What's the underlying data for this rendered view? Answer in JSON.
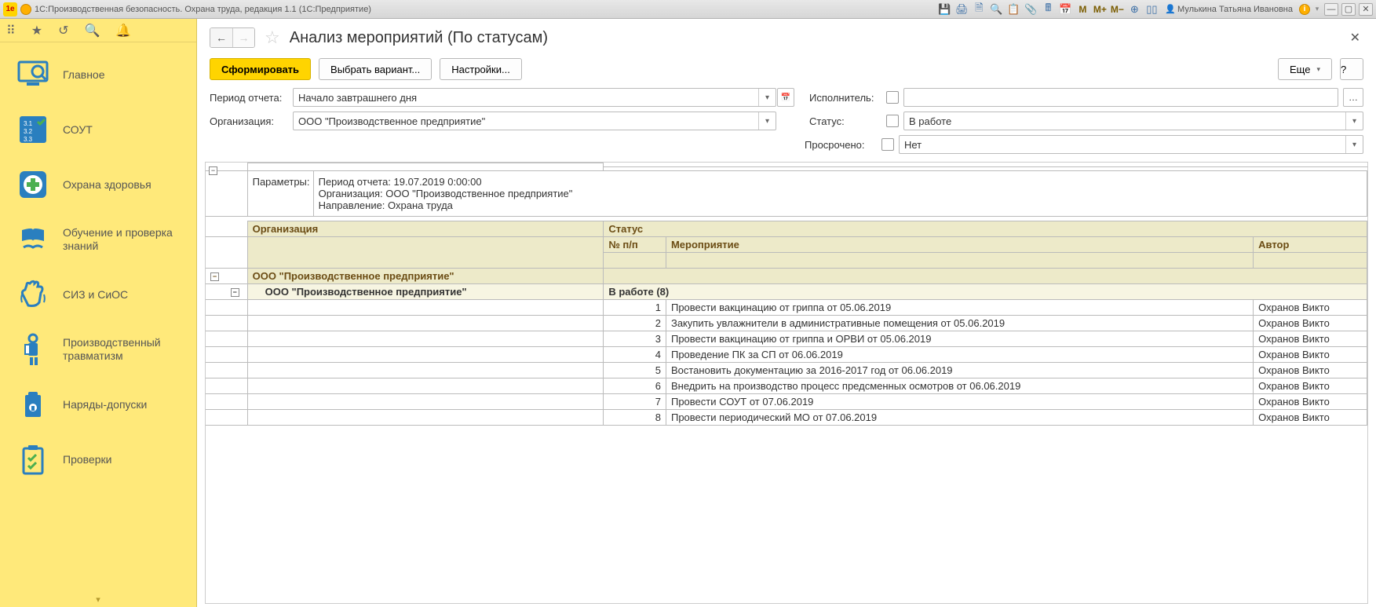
{
  "titlebar": {
    "title": "1С:Производственная безопасность. Охрана труда, редакция 1.1  (1С:Предприятие)",
    "user": "Мулькина Татьяна Ивановна",
    "icons": {
      "save": "save",
      "print": "print",
      "preview": "preview",
      "attach": "attach",
      "calc": "calc",
      "calendar": "calendar",
      "m": "M",
      "mplus": "M+",
      "mminus": "M−",
      "zoom": "zoom",
      "panels": "panels"
    }
  },
  "sidebar": {
    "top_icons": [
      "grid",
      "star",
      "history",
      "search",
      "bell"
    ],
    "items": [
      {
        "label": "Главное"
      },
      {
        "label": "СОУТ"
      },
      {
        "label": "Охрана здоровья"
      },
      {
        "label": "Обучение и проверка знаний"
      },
      {
        "label": "СИЗ и СиОС"
      },
      {
        "label": "Производственный травматизм"
      },
      {
        "label": "Наряды-допуски"
      },
      {
        "label": "Проверки"
      }
    ]
  },
  "page": {
    "title": "Анализ мероприятий (По статусам)"
  },
  "toolbar": {
    "generate": "Сформировать",
    "variant": "Выбрать вариант...",
    "settings": "Настройки...",
    "more": "Еще",
    "help": "?"
  },
  "filters": {
    "period_label": "Период отчета:",
    "period_value": "Начало завтрашнего дня",
    "org_label": "Организация:",
    "org_value": "ООО \"Производственное предприятие\"",
    "executor_label": "Исполнитель:",
    "executor_value": "",
    "status_label": "Статус:",
    "status_value": "В работе",
    "overdue_label": "Просрочено:",
    "overdue_value": "Нет"
  },
  "report": {
    "params_label": "Параметры:",
    "params": {
      "line1": "Период отчета: 19.07.2019 0:00:00",
      "line2": "Организация: ООО \"Производственное предприятие\"",
      "line3": "Направление: Охрана труда"
    },
    "headers": {
      "org": "Организация",
      "status": "Статус",
      "num": "№ п/п",
      "activity": "Мероприятие",
      "author": "Автор"
    },
    "group1": "ООО \"Производственное предприятие\"",
    "group2_org": "ООО \"Производственное предприятие\"",
    "group2_status": "В работе (8)",
    "rows": [
      {
        "n": "1",
        "act": "Провести вакцинацию от гриппа от 05.06.2019",
        "author": "Охранов Викто"
      },
      {
        "n": "2",
        "act": "Закупить увлажнители в административные помещения от 05.06.2019",
        "author": "Охранов Викто"
      },
      {
        "n": "3",
        "act": "Провести вакцинацию от гриппа и ОРВИ от 05.06.2019",
        "author": "Охранов Викто"
      },
      {
        "n": "4",
        "act": "Проведение ПК за СП от 06.06.2019",
        "author": "Охранов Викто"
      },
      {
        "n": "5",
        "act": "Востановить документацию за 2016-2017 год от 06.06.2019",
        "author": "Охранов Викто"
      },
      {
        "n": "6",
        "act": "Внедрить на производство процесс предсменных осмотров от 06.06.2019",
        "author": "Охранов Викто"
      },
      {
        "n": "7",
        "act": "Провести СОУТ от 07.06.2019",
        "author": "Охранов Викто"
      },
      {
        "n": "8",
        "act": "Провести периодический МО от 07.06.2019",
        "author": "Охранов Викто"
      }
    ]
  }
}
